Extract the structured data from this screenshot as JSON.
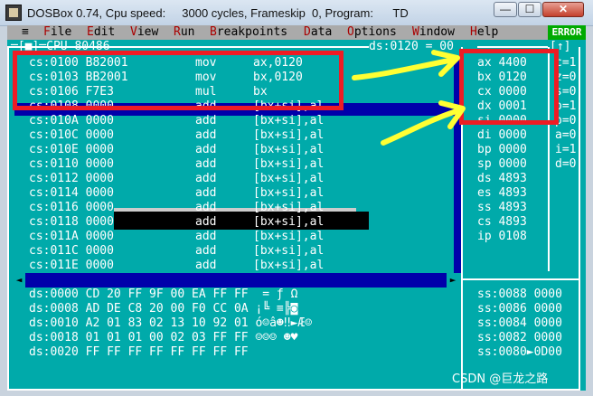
{
  "window": {
    "title": "DOSBox 0.74, Cpu speed:     3000 cycles, Frameskip  0, Program:      TD",
    "min_label": "—",
    "max_label": "☐",
    "close_label": "✕"
  },
  "menubar": {
    "system": "≡",
    "items": [
      "File",
      "Edit",
      "View",
      "Run",
      "Breakpoints",
      "Data",
      "Options",
      "Window",
      "Help"
    ],
    "error_badge": "ERROR"
  },
  "cpu_pane": {
    "title": "═[■]═CPU 80486",
    "ds_indicator": "ds:0120 = 00",
    "flags_title": "[↑]",
    "code": [
      {
        "addr": "cs:0100",
        "bytes": "B82001",
        "op": "mov",
        "args": "ax,0120"
      },
      {
        "addr": "cs:0103",
        "bytes": "BB2001",
        "op": "mov",
        "args": "bx,0120"
      },
      {
        "addr": "cs:0106",
        "bytes": "F7E3",
        "op": "mul",
        "args": "bx"
      },
      {
        "addr": "cs:0108",
        "bytes": "0000",
        "op": "add",
        "args": "[bx+si],al"
      },
      {
        "addr": "cs:010A",
        "bytes": "0000",
        "op": "add",
        "args": "[bx+si],al"
      },
      {
        "addr": "cs:010C",
        "bytes": "0000",
        "op": "add",
        "args": "[bx+si],al"
      },
      {
        "addr": "cs:010E",
        "bytes": "0000",
        "op": "add",
        "args": "[bx+si],al"
      },
      {
        "addr": "cs:0110",
        "bytes": "0000",
        "op": "add",
        "args": "[bx+si],al"
      },
      {
        "addr": "cs:0112",
        "bytes": "0000",
        "op": "add",
        "args": "[bx+si],al"
      },
      {
        "addr": "cs:0114",
        "bytes": "0000",
        "op": "add",
        "args": "[bx+si],al"
      },
      {
        "addr": "cs:0116",
        "bytes": "0000",
        "op": "add",
        "args": "[bx+si],al"
      },
      {
        "addr": "cs:0118",
        "bytes": "0000",
        "op": "add",
        "args": "[bx+si],al"
      },
      {
        "addr": "cs:011A",
        "bytes": "0000",
        "op": "add",
        "args": "[bx+si],al"
      },
      {
        "addr": "cs:011C",
        "bytes": "0000",
        "op": "add",
        "args": "[bx+si],al"
      },
      {
        "addr": "cs:011E",
        "bytes": "0000",
        "op": "add",
        "args": "[bx+si],al"
      }
    ],
    "registers": [
      {
        "name": "ax",
        "value": "4400"
      },
      {
        "name": "bx",
        "value": "0120"
      },
      {
        "name": "cx",
        "value": "0000"
      },
      {
        "name": "dx",
        "value": "0001"
      },
      {
        "name": "si",
        "value": "0000"
      },
      {
        "name": "di",
        "value": "0000"
      },
      {
        "name": "bp",
        "value": "0000"
      },
      {
        "name": "sp",
        "value": "0000"
      },
      {
        "name": "ds",
        "value": "4893"
      },
      {
        "name": "es",
        "value": "4893"
      },
      {
        "name": "ss",
        "value": "4893"
      },
      {
        "name": "cs",
        "value": "4893"
      },
      {
        "name": "ip",
        "value": "0108"
      }
    ],
    "flags": [
      "c=1",
      "z=0",
      "s=0",
      "o=1",
      "p=0",
      "a=0",
      "i=1",
      "d=0"
    ],
    "dump": [
      "ds:0000 CD 20 FF 9F 00 EA FF FF  = ƒ Ω",
      "ds:0008 AD DE C8 20 00 F0 CC 0A ¡╚ ≡╠◙",
      "ds:0010 A2 01 83 02 13 10 92 01 ó☺â☻‼►Æ☺",
      "ds:0018 01 01 01 00 02 03 FF FF ☺☺☺ ☻♥",
      "ds:0020 FF FF FF FF FF FF FF FF"
    ],
    "stack": [
      "ss:0088 0000",
      "ss:0086 0000",
      "ss:0084 0000",
      "ss:0082 0000",
      "ss:0080►0D00"
    ]
  },
  "watermark": "CSDN @巨龙之路",
  "colors": {
    "annotation_red": "#ee1c24",
    "annotation_yellow": "#ffff33",
    "dos_cyan": "#00aaaa",
    "dos_blue": "#0000aa"
  }
}
